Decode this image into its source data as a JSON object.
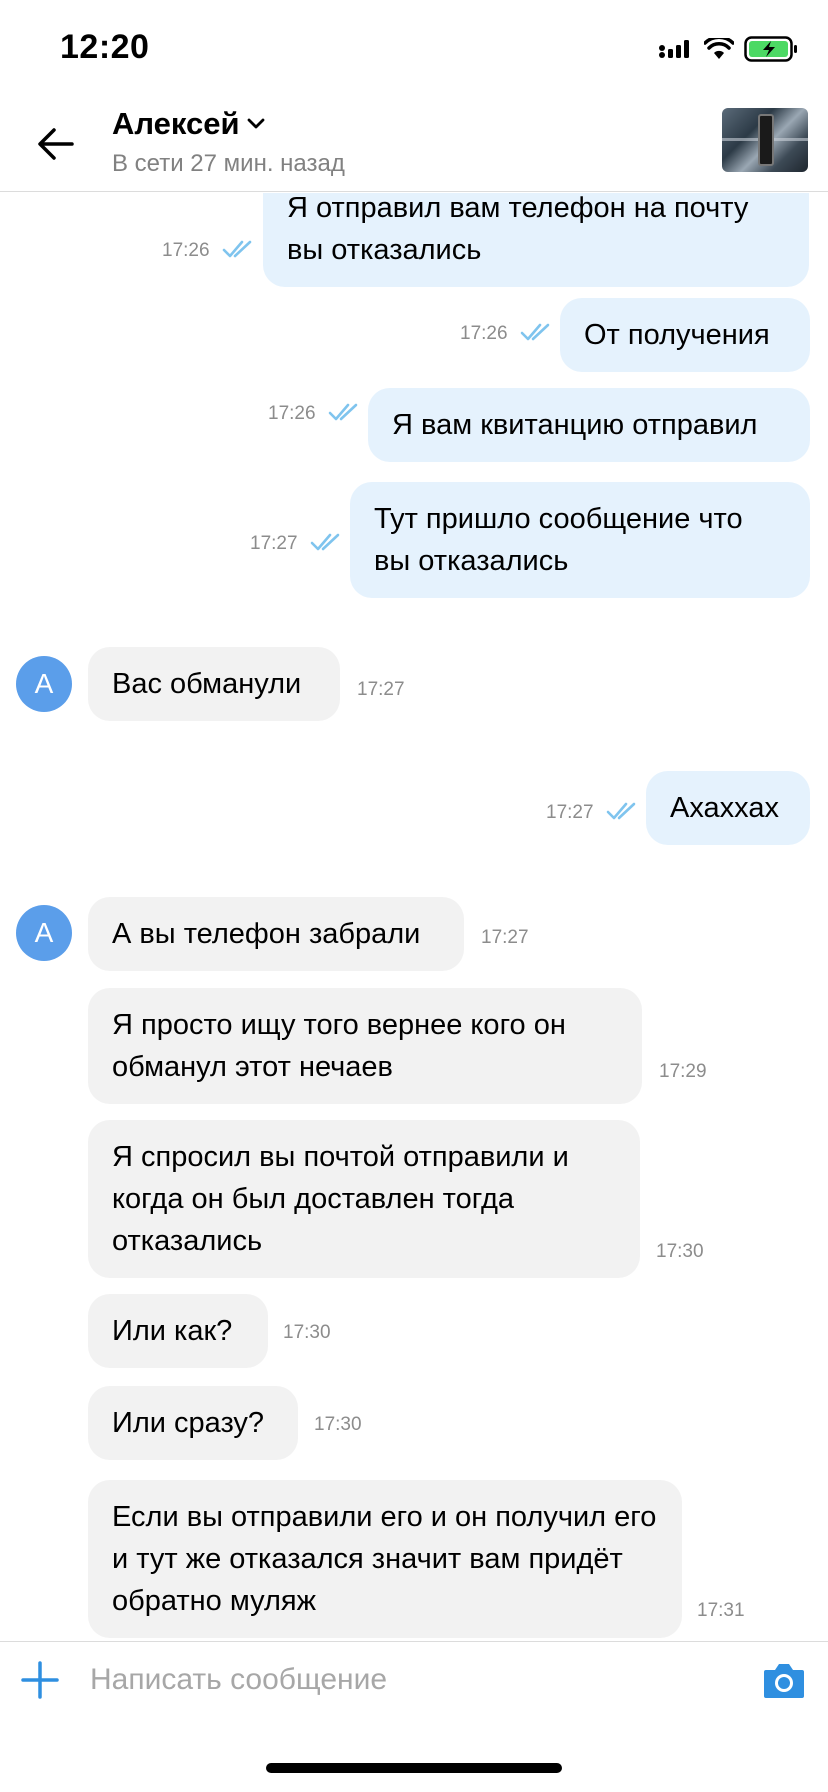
{
  "status_bar": {
    "time": "12:20",
    "icons": [
      "signal-icon",
      "wifi-icon",
      "battery-charging-icon"
    ]
  },
  "header": {
    "back_icon": "arrow-left-icon",
    "contact_name": "Алексей",
    "dropdown_icon": "chevron-down-icon",
    "status": "В сети 27 мин. назад"
  },
  "messages": [
    {
      "dir": "out",
      "text": "Я отправил вам телефон на почту вы отказались",
      "time": "17:26",
      "read": true
    },
    {
      "dir": "out",
      "text": "От получения",
      "time": "17:26",
      "read": true
    },
    {
      "dir": "out",
      "text": "Я вам квитанцию отправил",
      "time": "17:26",
      "read": true
    },
    {
      "dir": "out",
      "text": "Тут пришло сообщение что вы отказались",
      "time": "17:27",
      "read": true
    },
    {
      "dir": "in",
      "text": "Вас обманули",
      "time": "17:27",
      "avatar": "А"
    },
    {
      "dir": "out",
      "text": "Ахаххах",
      "time": "17:27",
      "read": true
    },
    {
      "dir": "in",
      "text": "А вы телефон забрали",
      "time": "17:27",
      "avatar": "А"
    },
    {
      "dir": "in",
      "text": "Я просто ищу того вернее кого он обманул этот нечаев",
      "time": "17:29"
    },
    {
      "dir": "in",
      "text": "Я спросил вы почтой отправили и когда он был доставлен тогда отказались",
      "time": "17:30"
    },
    {
      "dir": "in",
      "text": "Или как?",
      "time": "17:30"
    },
    {
      "dir": "in",
      "text": "Или сразу?",
      "time": "17:30"
    },
    {
      "dir": "in",
      "text": "Если вы отправили его и он получил его и тут же отказался значит вам придёт обратно муляж",
      "time": "17:31"
    }
  ],
  "composer": {
    "placeholder": "Написать сообщение",
    "add_icon": "plus-icon",
    "camera_icon": "camera-icon"
  },
  "colors": {
    "outgoing_bubble": "#e5f2fd",
    "incoming_bubble": "#f2f2f2",
    "accent": "#2f8fe0",
    "avatar": "#5b9eea",
    "read_ticks": "#7fc4ee"
  }
}
